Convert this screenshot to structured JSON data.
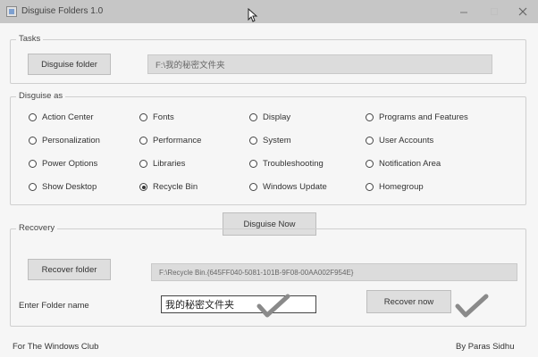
{
  "window": {
    "title": "Disguise Folders 1.0"
  },
  "tasks": {
    "legend": "Tasks",
    "disguise_folder_label": "Disguise folder",
    "folder_path": "F:\\我的秘密文件夹"
  },
  "disguise_as": {
    "legend": "Disguise as",
    "options": [
      {
        "label": "Action Center",
        "selected": false
      },
      {
        "label": "Fonts",
        "selected": false
      },
      {
        "label": "Display",
        "selected": false
      },
      {
        "label": "Programs and Features",
        "selected": false
      },
      {
        "label": "Personalization",
        "selected": false
      },
      {
        "label": "Performance",
        "selected": false
      },
      {
        "label": "System",
        "selected": false
      },
      {
        "label": "User Accounts",
        "selected": false
      },
      {
        "label": "Power Options",
        "selected": false
      },
      {
        "label": "Libraries",
        "selected": false
      },
      {
        "label": "Troubleshooting",
        "selected": false
      },
      {
        "label": "Notification Area",
        "selected": false
      },
      {
        "label": "Show Desktop",
        "selected": false
      },
      {
        "label": "Recycle Bin",
        "selected": true
      },
      {
        "label": "Windows Update",
        "selected": false
      },
      {
        "label": "Homegroup",
        "selected": false
      }
    ]
  },
  "disguise_now_label": "Disguise Now",
  "recovery": {
    "legend": "Recovery",
    "recover_folder_label": "Recover folder",
    "recovered_path": "F:\\Recycle Bin.{645FF040-5081-101B-9F08-00AA002F954E}",
    "folder_name_label": "Enter Folder name",
    "folder_name_value": "我的秘密文件夹",
    "recover_now_label": "Recover now"
  },
  "footer": {
    "left": "For The Windows Club",
    "right": "By Paras Sidhu"
  },
  "colors": {
    "check_mark": "#8a8a8a",
    "button_bg": "#dedede",
    "field_bg": "#dcdcdc"
  }
}
